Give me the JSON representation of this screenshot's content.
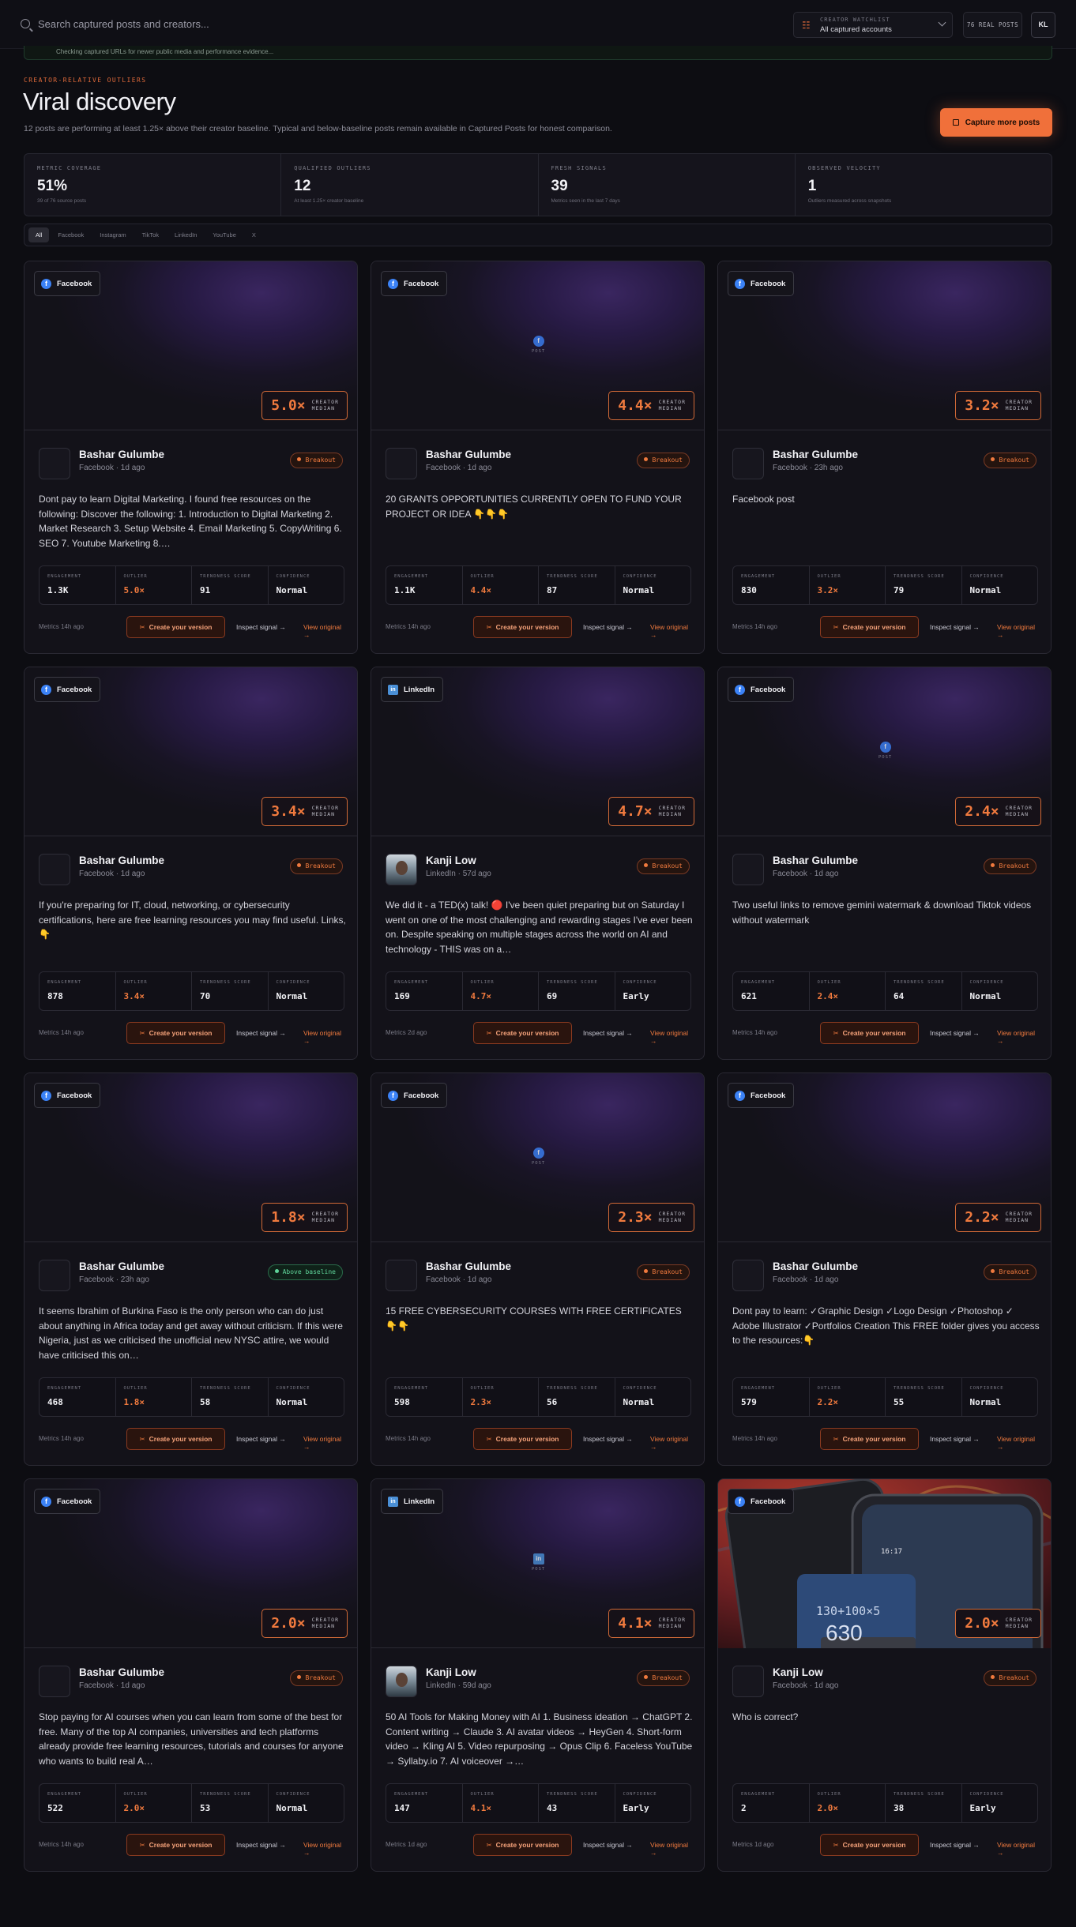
{
  "topbar": {
    "search_placeholder": "Search captured posts and creators...",
    "watchlist_label": "CREATOR WATCHLIST",
    "watchlist_value": "All captured accounts",
    "real_posts": "76 REAL POSTS",
    "avatar_initials": "KL"
  },
  "notice": "Checking captured URLs for newer public media and performance evidence...",
  "header": {
    "eyebrow": "CREATOR-RELATIVE OUTLIERS",
    "title": "Viral discovery",
    "subtitle": "12 posts are performing at least 1.25× above their creator baseline. Typical and below-baseline posts remain available in Captured Posts for honest comparison.",
    "capture_button": "Capture more posts"
  },
  "stats": [
    {
      "label": "METRIC COVERAGE",
      "value": "51%",
      "hint": "39 of 76 source posts"
    },
    {
      "label": "QUALIFIED OUTLIERS",
      "value": "12",
      "hint": "At least 1.25× creator baseline"
    },
    {
      "label": "FRESH SIGNALS",
      "value": "39",
      "hint": "Metrics seen in the last 7 days"
    },
    {
      "label": "OBSERVED VELOCITY",
      "value": "1",
      "hint": "Outliers measured across snapshots"
    }
  ],
  "filters": [
    "All",
    "Facebook",
    "Instagram",
    "TikTok",
    "LinkedIn",
    "YouTube",
    "X"
  ],
  "labels": {
    "multiplier_top": "CREATOR",
    "multiplier_bottom": "MEDIAN",
    "media_placeholder": "POST",
    "metric_engagement": "ENGAGEMENT",
    "metric_outlier": "OUTLIER",
    "metric_trend": "TRENDNESS SCORE",
    "metric_confidence": "CONFIDENCE",
    "create": "Create your version",
    "inspect": "Inspect signal",
    "view": "View original"
  },
  "cards": [
    {
      "platform": "Facebook",
      "multiplier": "5.0×",
      "author": "Bashar Gulumbe",
      "meta": "Facebook · 1d ago",
      "badge": "Breakout",
      "text": "Dont pay to learn Digital Marketing. I found free resources on the following: Discover the following: 1. Introduction to Digital Marketing 2. Market Research 3. Setup Website 4. Email Marketing 5. CopyWriting 6. SEO 7. Youtube Marketing 8.…",
      "engagement": "1.3K",
      "outlier": "5.0×",
      "trend": "91",
      "confidence": "Normal",
      "metrics_age": "Metrics 14h ago"
    },
    {
      "platform": "Facebook",
      "multiplier": "4.4×",
      "author": "Bashar Gulumbe",
      "meta": "Facebook · 1d ago",
      "badge": "Breakout",
      "text": "20 GRANTS OPPORTUNITIES CURRENTLY OPEN TO FUND YOUR PROJECT OR IDEA 👇👇👇",
      "engagement": "1.1K",
      "outlier": "4.4×",
      "trend": "87",
      "confidence": "Normal",
      "metrics_age": "Metrics 14h ago"
    },
    {
      "platform": "Facebook",
      "multiplier": "3.2×",
      "author": "Bashar Gulumbe",
      "meta": "Facebook · 23h ago",
      "badge": "Breakout",
      "text": "Facebook post",
      "engagement": "830",
      "outlier": "3.2×",
      "trend": "79",
      "confidence": "Normal",
      "metrics_age": "Metrics 14h ago"
    },
    {
      "platform": "Facebook",
      "multiplier": "3.4×",
      "author": "Bashar Gulumbe",
      "meta": "Facebook · 1d ago",
      "badge": "Breakout",
      "text": "If you're preparing for IT, cloud, networking, or cybersecurity certifications, here are free learning resources you may find useful. Links,👇",
      "engagement": "878",
      "outlier": "3.4×",
      "trend": "70",
      "confidence": "Normal",
      "metrics_age": "Metrics 14h ago"
    },
    {
      "platform": "LinkedIn",
      "multiplier": "4.7×",
      "author": "Kanji Low",
      "meta": "LinkedIn · 57d ago",
      "badge": "Breakout",
      "text": "We did it - a TED(x) talk! 🔴 I've been quiet preparing but on Saturday I went on one of the most challenging and rewarding stages I've ever been on. Despite speaking on multiple stages across the world on AI and technology - THIS was on a…",
      "engagement": "169",
      "outlier": "4.7×",
      "trend": "69",
      "confidence": "Early",
      "metrics_age": "Metrics 2d ago"
    },
    {
      "platform": "Facebook",
      "multiplier": "2.4×",
      "author": "Bashar Gulumbe",
      "meta": "Facebook · 1d ago",
      "badge": "Breakout",
      "text": "Two useful links to remove gemini watermark & download Tiktok videos without watermark",
      "engagement": "621",
      "outlier": "2.4×",
      "trend": "64",
      "confidence": "Normal",
      "metrics_age": "Metrics 14h ago"
    },
    {
      "platform": "Facebook",
      "multiplier": "1.8×",
      "author": "Bashar Gulumbe",
      "meta": "Facebook · 23h ago",
      "badge": "Above baseline",
      "text": "It seems Ibrahim of Burkina Faso is the only person who can do just about anything in Africa today and get away without criticism. If this were Nigeria, just as we criticised the unofficial new NYSC attire, we would have criticised this on…",
      "engagement": "468",
      "outlier": "1.8×",
      "trend": "58",
      "confidence": "Normal",
      "metrics_age": "Metrics 14h ago"
    },
    {
      "platform": "Facebook",
      "multiplier": "2.3×",
      "author": "Bashar Gulumbe",
      "meta": "Facebook · 1d ago",
      "badge": "Breakout",
      "text": "15 FREE CYBERSECURITY COURSES WITH FREE CERTIFICATES 👇👇",
      "engagement": "598",
      "outlier": "2.3×",
      "trend": "56",
      "confidence": "Normal",
      "metrics_age": "Metrics 14h ago"
    },
    {
      "platform": "Facebook",
      "multiplier": "2.2×",
      "author": "Bashar Gulumbe",
      "meta": "Facebook · 1d ago",
      "badge": "Breakout",
      "text": "Dont pay to learn: ✓Graphic Design ✓Logo Design ✓Photoshop ✓ Adobe Illustrator ✓Portfolios Creation This FREE folder gives you access to the resources:👇",
      "engagement": "579",
      "outlier": "2.2×",
      "trend": "55",
      "confidence": "Normal",
      "metrics_age": "Metrics 14h ago"
    },
    {
      "platform": "Facebook",
      "multiplier": "2.0×",
      "author": "Bashar Gulumbe",
      "meta": "Facebook · 1d ago",
      "badge": "Breakout",
      "text": "Stop paying for AI courses when you can learn from some of the best for free. Many of the top AI companies, universities and tech platforms already provide free learning resources, tutorials and courses for anyone who wants to build real A…",
      "engagement": "522",
      "outlier": "2.0×",
      "trend": "53",
      "confidence": "Normal",
      "metrics_age": "Metrics 14h ago"
    },
    {
      "platform": "LinkedIn",
      "multiplier": "4.1×",
      "author": "Kanji Low",
      "meta": "LinkedIn · 59d ago",
      "badge": "Breakout",
      "text": "50 AI Tools for Making Money with AI 1. Business ideation → ChatGPT 2. Content writing → Claude 3. AI avatar videos → HeyGen 4. Short-form video → Kling AI 5. Video repurposing → Opus Clip 6. Faceless YouTube → Syllaby.io 7. AI voiceover →…",
      "engagement": "147",
      "outlier": "4.1×",
      "trend": "43",
      "confidence": "Early",
      "metrics_age": "Metrics 1d ago"
    },
    {
      "platform": "Facebook",
      "multiplier": "2.0×",
      "author": "Kanji Low",
      "meta": "Facebook · 1d ago",
      "badge": "Breakout",
      "text": "Who is correct?",
      "engagement": "2",
      "outlier": "2.0×",
      "trend": "38",
      "confidence": "Early",
      "metrics_age": "Metrics 1d ago",
      "photo_text": [
        "130+100×5",
        "630",
        "16:17"
      ]
    }
  ]
}
